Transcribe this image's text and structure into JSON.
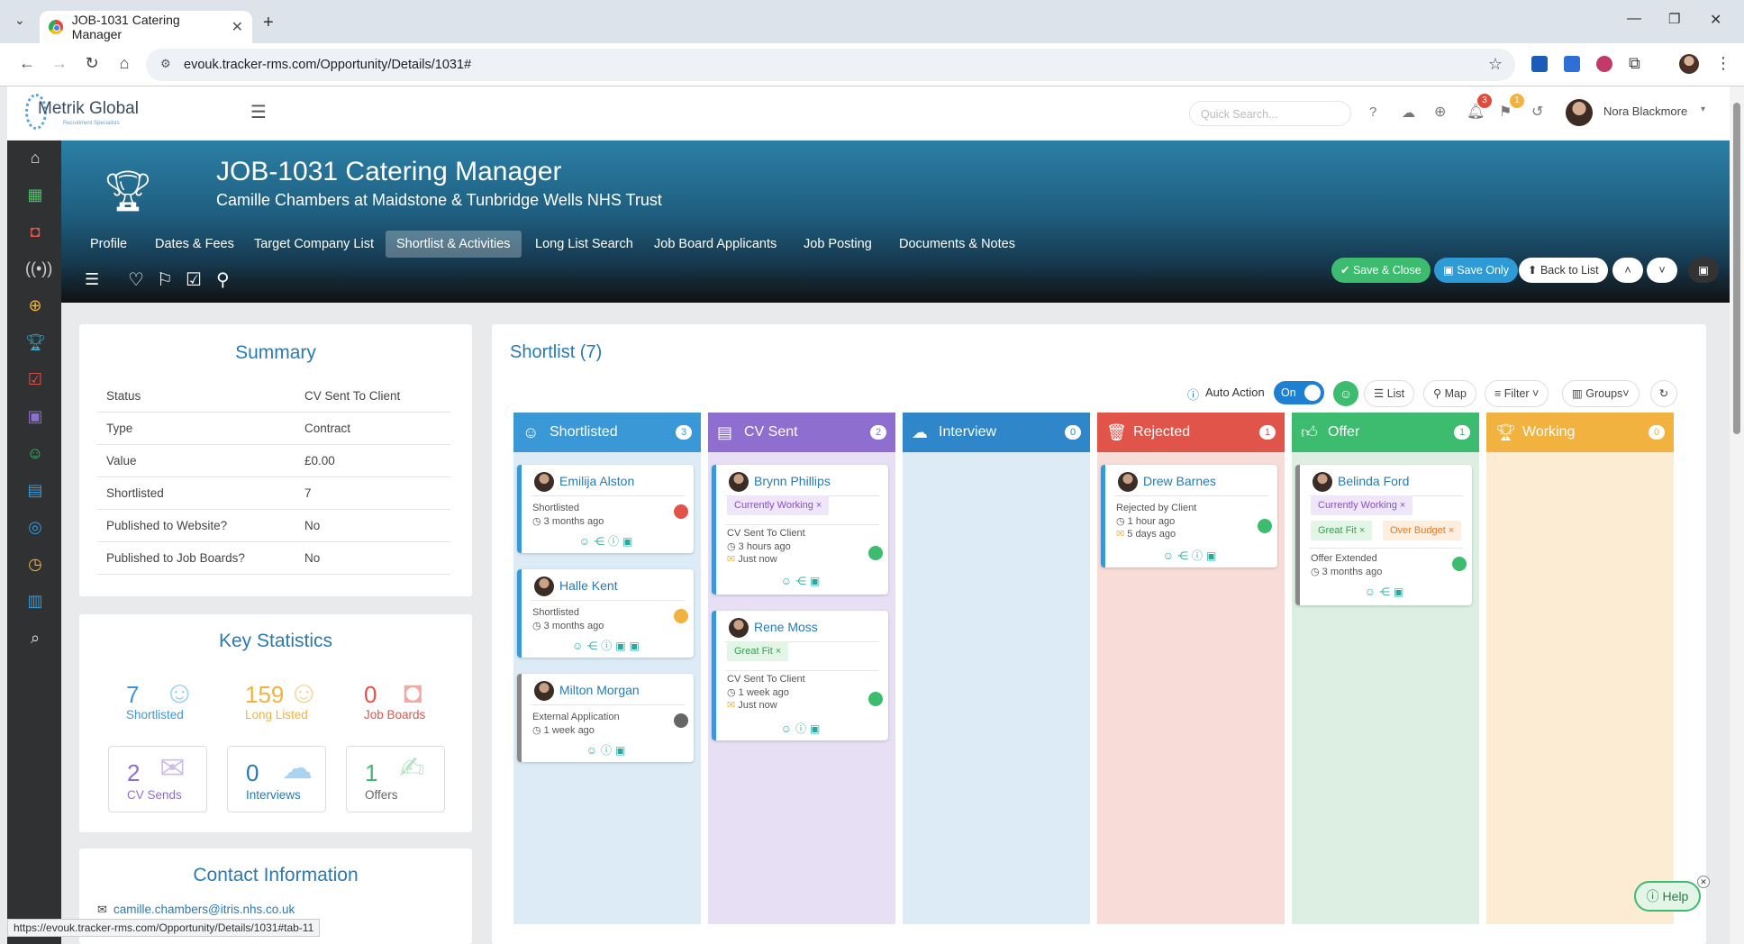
{
  "browser": {
    "tab_title": "JOB-1031 Catering Manager",
    "url": "evouk.tracker-rms.com/Opportunity/Details/1031#",
    "status_url": "https://evouk.tracker-rms.com/Opportunity/Details/1031#tab-11"
  },
  "header": {
    "logo_text": "Metrik Global",
    "logo_tagline": "Recruitment Specialists",
    "search_placeholder": "Quick Search...",
    "notif_count": "3",
    "flag_count": "1",
    "user_name": "Nora Blackmore"
  },
  "hero": {
    "title": "JOB-1031 Catering Manager",
    "subtitle": "Camille Chambers at Maidstone & Tunbridge Wells NHS Trust",
    "tabs": [
      "Profile",
      "Dates & Fees",
      "Target Company List",
      "Shortlist & Activities",
      "Long List Search",
      "Job Board Applicants",
      "Job Posting",
      "Documents & Notes"
    ],
    "active_tab": "Shortlist & Activities",
    "save_close": "Save & Close",
    "save_only": "Save Only",
    "back_to_list": "Back to List"
  },
  "summary": {
    "title": "Summary",
    "rows": [
      {
        "key": "Status",
        "value": "CV Sent To Client"
      },
      {
        "key": "Type",
        "value": "Contract"
      },
      {
        "key": "Value",
        "value": "£0.00"
      },
      {
        "key": "Shortlisted",
        "value": "7"
      },
      {
        "key": "Published to Website?",
        "value": "No"
      },
      {
        "key": "Published to Job Boards?",
        "value": "No"
      }
    ]
  },
  "key_stats": {
    "title": "Key Statistics",
    "shortlisted": {
      "value": "7",
      "label": "Shortlisted"
    },
    "long_listed": {
      "value": "159",
      "label": "Long Listed"
    },
    "job_boards": {
      "value": "0",
      "label": "Job Boards"
    },
    "cv_sends": {
      "value": "2",
      "label": "CV Sends"
    },
    "interviews": {
      "value": "0",
      "label": "Interviews"
    },
    "offers": {
      "value": "1",
      "label": "Offers"
    }
  },
  "contact": {
    "title": "Contact Information",
    "email": "camille.chambers@itris.nhs.co.uk"
  },
  "shortlist": {
    "title": "Shortlist (7)",
    "auto_action": "Auto Action",
    "toggle": "On",
    "tools": {
      "list": "List",
      "map": "Map",
      "filter": "Filter",
      "groups": "Groups"
    },
    "columns": [
      {
        "name": "Shortlisted",
        "count": "3",
        "color": "#3a98d6",
        "bg": "#dcebf5"
      },
      {
        "name": "CV Sent",
        "count": "2",
        "color": "#8e6fd0",
        "bg": "#e7e0f5"
      },
      {
        "name": "Interview",
        "count": "0",
        "color": "#2f86c8",
        "bg": "#dcebf5"
      },
      {
        "name": "Rejected",
        "count": "1",
        "color": "#e0544a",
        "bg": "#f7dcd8"
      },
      {
        "name": "Offer",
        "count": "1",
        "color": "#3dbb6f",
        "bg": "#dcefe2"
      },
      {
        "name": "Working",
        "count": "0",
        "color": "#f2b23f",
        "bg": "#fcecd4"
      }
    ],
    "cards": {
      "emilija": {
        "name": "Emilija Alston",
        "status": "Shortlisted",
        "time": "3 months ago"
      },
      "halle": {
        "name": "Halle Kent",
        "status": "Shortlisted",
        "time": "3 months ago"
      },
      "milton": {
        "name": "Milton Morgan",
        "status": "External Application",
        "time": "1 week ago"
      },
      "brynn": {
        "name": "Brynn Phillips",
        "tag": "Currently Working ×",
        "status": "CV Sent To Client",
        "time": "3 hours ago",
        "time2": "Just now"
      },
      "rene": {
        "name": "Rene Moss",
        "tag": "Great Fit ×",
        "status": "CV Sent To Client",
        "time": "1 week ago",
        "time2": "Just now"
      },
      "drew": {
        "name": "Drew Barnes",
        "status": "Rejected by Client",
        "time": "1 hour ago",
        "time2": "5 days ago"
      },
      "belinda": {
        "name": "Belinda Ford",
        "tag": "Currently Working ×",
        "tag2": "Great Fit ×",
        "tag3": "Over Budget ×",
        "status": "Offer Extended",
        "time": "3 months ago"
      }
    }
  },
  "help": "Help"
}
